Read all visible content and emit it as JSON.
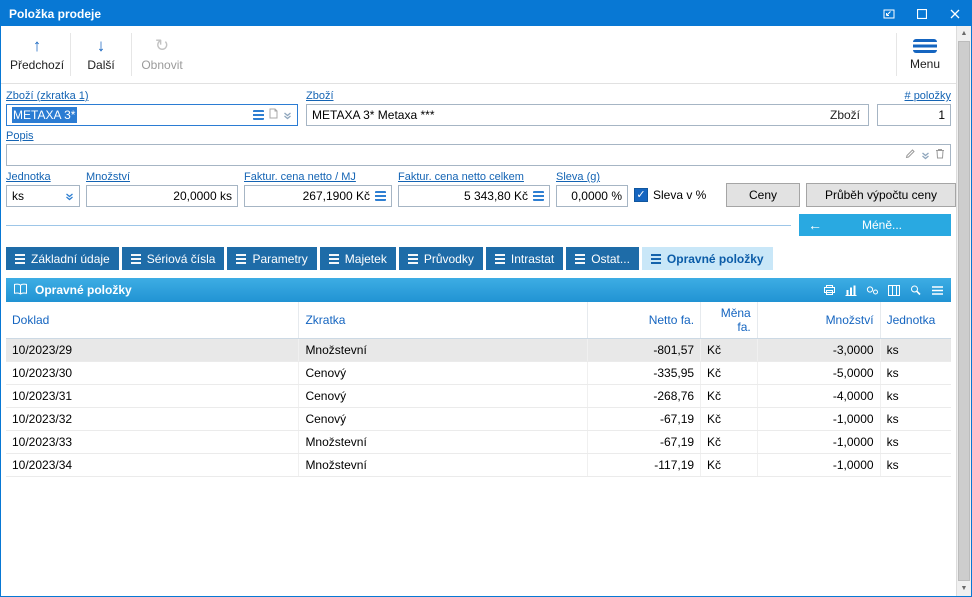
{
  "window": {
    "title": "Položka prodeje"
  },
  "toolbar": {
    "buttons": [
      {
        "id": "previous",
        "label": "Předchozí",
        "glyph": "↑",
        "enabled": true
      },
      {
        "id": "next",
        "label": "Další",
        "glyph": "↓",
        "enabled": true
      },
      {
        "id": "refresh",
        "label": "Obnovit",
        "glyph": "↻",
        "enabled": false
      }
    ],
    "menu_label": "Menu"
  },
  "form": {
    "zbozi_zkratka": {
      "label": "Zboží (zkratka 1)",
      "value": "METAXA 3*"
    },
    "zbozi": {
      "label": "Zboží",
      "value": "METAXA 3* Metaxa ***",
      "inner_button": "Zboží"
    },
    "pocet_polozek": {
      "label": "# položky",
      "value": "1"
    },
    "popis": {
      "label": "Popis",
      "value": ""
    },
    "jednotka": {
      "label": "Jednotka",
      "value": "ks"
    },
    "mnozstvi": {
      "label": "Množství",
      "value": "20,0000 ks"
    },
    "cena_mj": {
      "label": "Faktur. cena netto / MJ",
      "value": "267,1900 Kč"
    },
    "cena_celkem": {
      "label": "Faktur. cena netto celkem",
      "value": "5 343,80 Kč"
    },
    "sleva": {
      "label": "Sleva (g)",
      "value": "0,0000 %"
    },
    "sleva_v_procentech": {
      "label": "Sleva v %",
      "checked": true
    },
    "buttons": {
      "ceny": "Ceny",
      "prubeh": "Průběh výpočtu ceny",
      "mene": "Méně..."
    }
  },
  "tabs": [
    {
      "id": "zakladni-udaje",
      "label": "Základní údaje",
      "active": false
    },
    {
      "id": "seriova-cisla",
      "label": "Sériová čísla",
      "active": false
    },
    {
      "id": "parametry",
      "label": "Parametry",
      "active": false
    },
    {
      "id": "majetek",
      "label": "Majetek",
      "active": false
    },
    {
      "id": "pruvodky",
      "label": "Průvodky",
      "active": false
    },
    {
      "id": "intrastat",
      "label": "Intrastat",
      "active": false
    },
    {
      "id": "ostatni",
      "label": "Ostat...",
      "active": false
    },
    {
      "id": "opravne-polozky",
      "label": "Opravné položky",
      "active": true
    }
  ],
  "panel": {
    "title": "Opravné položky"
  },
  "table": {
    "columns": [
      "Doklad",
      "Zkratka",
      "Netto fa.",
      "Měna fa.",
      "Množství",
      "Jednotka"
    ],
    "rows": [
      [
        "10/2023/29",
        "Množstevní",
        "-801,57",
        "Kč",
        "-3,0000",
        "ks"
      ],
      [
        "10/2023/30",
        "Cenový",
        "-335,95",
        "Kč",
        "-5,0000",
        "ks"
      ],
      [
        "10/2023/31",
        "Cenový",
        "-268,76",
        "Kč",
        "-4,0000",
        "ks"
      ],
      [
        "10/2023/32",
        "Cenový",
        "-67,19",
        "Kč",
        "-1,0000",
        "ks"
      ],
      [
        "10/2023/33",
        "Množstevní",
        "-67,19",
        "Kč",
        "-1,0000",
        "ks"
      ],
      [
        "10/2023/34",
        "Množstevní",
        "-117,19",
        "Kč",
        "-1,0000",
        "ks"
      ]
    ],
    "selected_row_index": 0
  },
  "icons": {
    "check": "✓",
    "left_arrow": "←",
    "scroll_up": "▲",
    "scroll_down": "▼"
  },
  "colors": {
    "titlebar": "#0878d4",
    "accent_blue": "#1565c0",
    "bright_blue": "#29a9e1",
    "tab_inactive": "#1e6ca8",
    "tab_active_bg": "#c9e7f8",
    "panel_header": "#2f9fdb",
    "selection_bg": "#2b7cd3",
    "selected_row_bg": "#e8e8e8"
  }
}
